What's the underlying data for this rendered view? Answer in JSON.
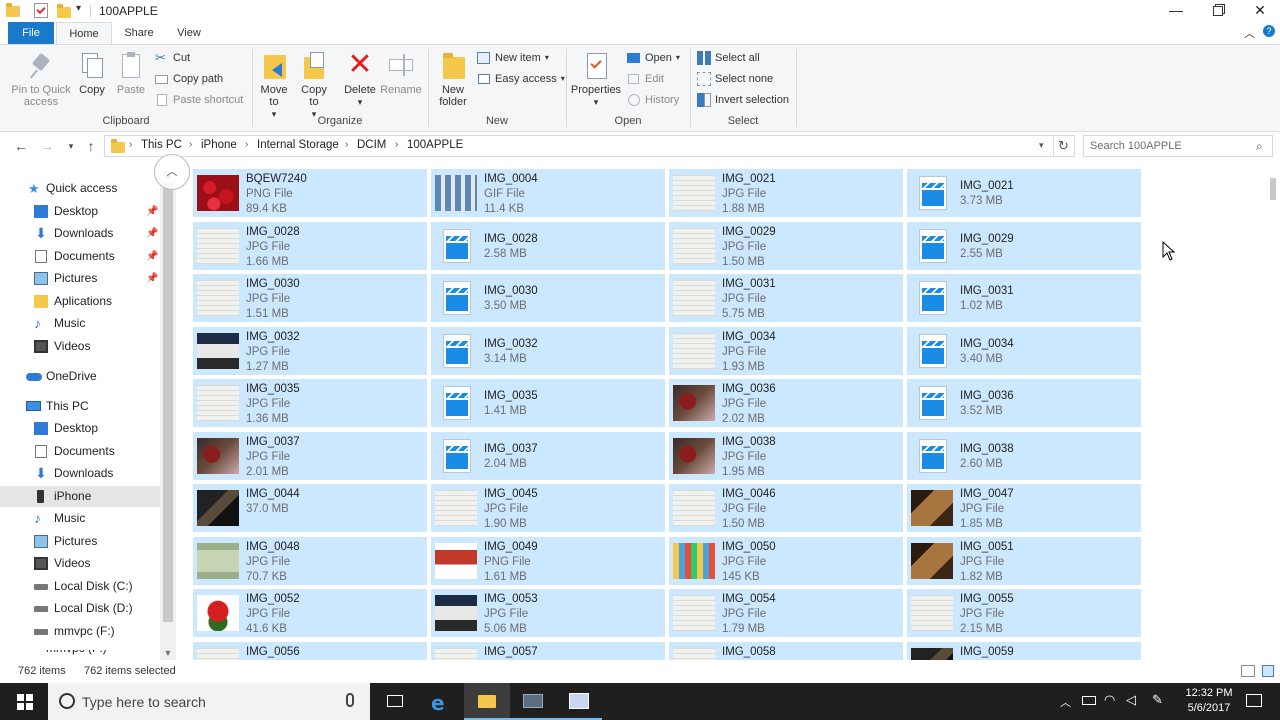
{
  "window": {
    "title": "100APPLE"
  },
  "tabs": [
    "File",
    "Home",
    "Share",
    "View"
  ],
  "ribbon": {
    "clipboard": {
      "label": "Clipboard",
      "pin": "Pin to Quick access",
      "copy": "Copy",
      "paste": "Paste",
      "cut": "Cut",
      "copy_path": "Copy path",
      "paste_shortcut": "Paste shortcut"
    },
    "organize": {
      "label": "Organize",
      "move_to": "Move to",
      "copy_to": "Copy to",
      "delete": "Delete",
      "rename": "Rename"
    },
    "new": {
      "label": "New",
      "new_folder": "New folder",
      "new_item": "New item",
      "easy_access": "Easy access"
    },
    "open": {
      "label": "Open",
      "properties": "Properties",
      "open": "Open",
      "edit": "Edit",
      "history": "History"
    },
    "select": {
      "label": "Select",
      "select_all": "Select all",
      "select_none": "Select none",
      "invert_selection": "Invert selection"
    }
  },
  "address": {
    "crumbs": [
      "This PC",
      "iPhone",
      "Internal Storage",
      "DCIM",
      "100APPLE"
    ],
    "search_placeholder": "Search 100APPLE"
  },
  "nav": {
    "quick_access": "Quick access",
    "quick_items": [
      "Desktop",
      "Downloads",
      "Documents",
      "Pictures",
      "Aplications",
      "Music",
      "Videos"
    ],
    "onedrive": "OneDrive",
    "this_pc": "This PC",
    "pc_items": [
      "Desktop",
      "Documents",
      "Downloads",
      "iPhone",
      "Music",
      "Pictures",
      "Videos",
      "Local Disk (C:)",
      "Local Disk (D:)",
      "mmvpc (F:)",
      "mmvpc (F:)"
    ]
  },
  "files": [
    [
      {
        "name": "BQEW7240",
        "type": "PNG File",
        "size": "89.4 KB",
        "thumb": "roses"
      },
      {
        "name": "IMG_0028",
        "type": "JPG File",
        "size": "1.66 MB",
        "thumb": "doc"
      },
      {
        "name": "IMG_0030",
        "type": "JPG File",
        "size": "1.51 MB",
        "thumb": "doc"
      },
      {
        "name": "IMG_0032",
        "type": "JPG File",
        "size": "1.27 MB",
        "thumb": "screen"
      },
      {
        "name": "IMG_0035",
        "type": "JPG File",
        "size": "1.36 MB",
        "thumb": "doc"
      },
      {
        "name": "IMG_0037",
        "type": "JPG File",
        "size": "2.01 MB",
        "thumb": "photo"
      },
      {
        "name": "IMG_0044",
        "type": "",
        "size": "37.0 MB",
        "thumb": "dark"
      },
      {
        "name": "IMG_0048",
        "type": "JPG File",
        "size": "70.7 KB",
        "thumb": "money"
      },
      {
        "name": "IMG_0052",
        "type": "JPG File",
        "size": "41.6 KB",
        "thumb": "rooster"
      },
      {
        "name": "IMG_0056",
        "type": "",
        "size": "",
        "thumb": "doc"
      }
    ],
    [
      {
        "name": "IMG_0004",
        "type": "GIF File",
        "size": "11.4 KB",
        "thumb": "gif"
      },
      {
        "name": "IMG_0028",
        "type": "",
        "size": "2.58 MB",
        "thumb": "video"
      },
      {
        "name": "IMG_0030",
        "type": "",
        "size": "3.50 MB",
        "thumb": "video"
      },
      {
        "name": "IMG_0032",
        "type": "",
        "size": "3.14 MB",
        "thumb": "video"
      },
      {
        "name": "IMG_0035",
        "type": "",
        "size": "1.41 MB",
        "thumb": "video"
      },
      {
        "name": "IMG_0037",
        "type": "",
        "size": "2.04 MB",
        "thumb": "video"
      },
      {
        "name": "IMG_0045",
        "type": "JPG File",
        "size": "1.90 MB",
        "thumb": "doc"
      },
      {
        "name": "IMG_0049",
        "type": "PNG File",
        "size": "1.61 MB",
        "thumb": "sign"
      },
      {
        "name": "IMG_0053",
        "type": "JPG File",
        "size": "5.06 MB",
        "thumb": "screen"
      },
      {
        "name": "IMG_0057",
        "type": "",
        "size": "",
        "thumb": "doc"
      }
    ],
    [
      {
        "name": "IMG_0021",
        "type": "JPG File",
        "size": "1.88 MB",
        "thumb": "doc"
      },
      {
        "name": "IMG_0029",
        "type": "JPG File",
        "size": "1.50 MB",
        "thumb": "doc"
      },
      {
        "name": "IMG_0031",
        "type": "JPG File",
        "size": "5.75 MB",
        "thumb": "doc"
      },
      {
        "name": "IMG_0034",
        "type": "JPG File",
        "size": "1.93 MB",
        "thumb": "doc"
      },
      {
        "name": "IMG_0036",
        "type": "JPG File",
        "size": "2.02 MB",
        "thumb": "photo"
      },
      {
        "name": "IMG_0038",
        "type": "JPG File",
        "size": "1.95 MB",
        "thumb": "photo"
      },
      {
        "name": "IMG_0046",
        "type": "JPG File",
        "size": "1.50 MB",
        "thumb": "doc"
      },
      {
        "name": "IMG_0050",
        "type": "JPG File",
        "size": "145 KB",
        "thumb": "colorful"
      },
      {
        "name": "IMG_0054",
        "type": "JPG File",
        "size": "1.79 MB",
        "thumb": "doc"
      },
      {
        "name": "IMG_0058",
        "type": "",
        "size": "",
        "thumb": "doc"
      }
    ],
    [
      {
        "name": "IMG_0021",
        "type": "",
        "size": "3.73 MB",
        "thumb": "video"
      },
      {
        "name": "IMG_0029",
        "type": "",
        "size": "2.55 MB",
        "thumb": "video"
      },
      {
        "name": "IMG_0031",
        "type": "",
        "size": "1.02 MB",
        "thumb": "video"
      },
      {
        "name": "IMG_0034",
        "type": "",
        "size": "3.40 MB",
        "thumb": "video"
      },
      {
        "name": "IMG_0036",
        "type": "",
        "size": "3.52 MB",
        "thumb": "video"
      },
      {
        "name": "IMG_0038",
        "type": "",
        "size": "2.60 MB",
        "thumb": "video"
      },
      {
        "name": "IMG_0047",
        "type": "JPG File",
        "size": "1.85 MB",
        "thumb": "brown"
      },
      {
        "name": "IMG_0051",
        "type": "JPG File",
        "size": "1.82 MB",
        "thumb": "brown"
      },
      {
        "name": "IMG_0055",
        "type": "JPG File",
        "size": "2.15 MB",
        "thumb": "doc"
      },
      {
        "name": "IMG_0059",
        "type": "",
        "size": "",
        "thumb": "dark"
      }
    ]
  ],
  "status": {
    "count": "762 items",
    "selected": "762 items selected"
  },
  "taskbar": {
    "search_placeholder": "Type here to search",
    "time": "12:32 PM",
    "date": "5/6/2017"
  },
  "colors": {
    "accent": "#1979ca",
    "selection": "#cce8ff",
    "taskbar": "#1f1f1f"
  }
}
